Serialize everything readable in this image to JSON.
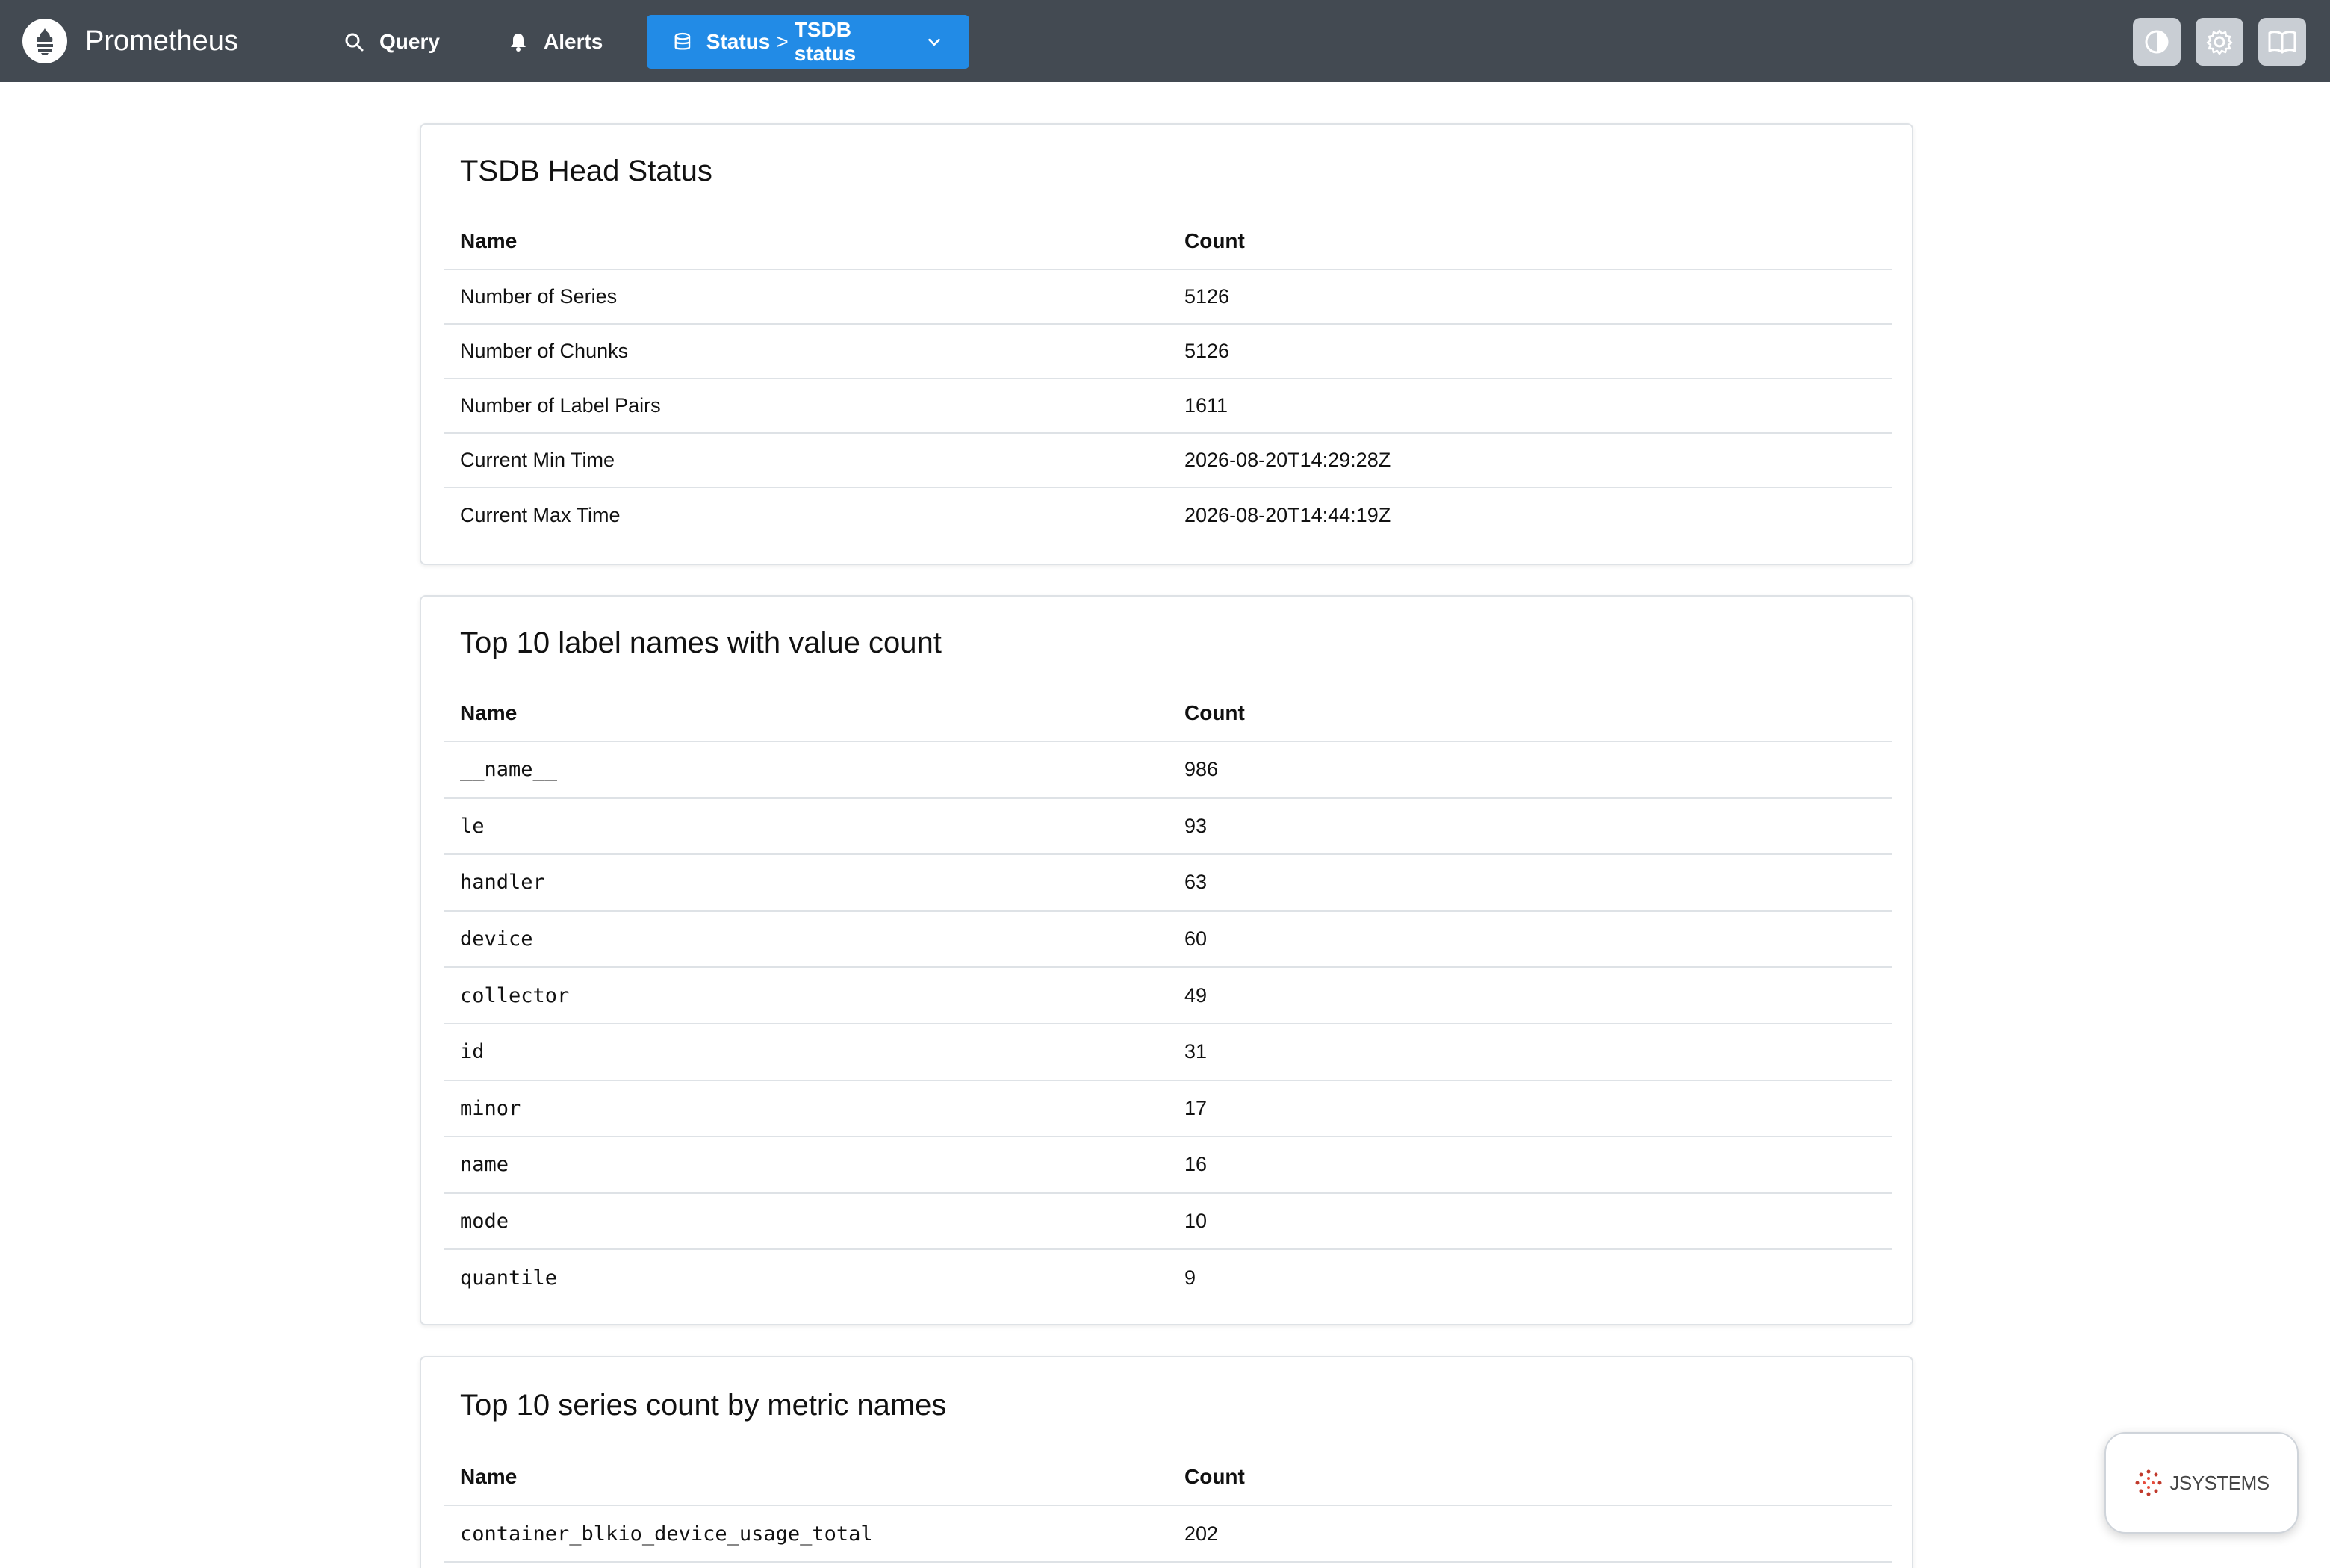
{
  "navbar": {
    "brand": "Prometheus",
    "query_label": "Query",
    "alerts_label": "Alerts",
    "status_label": "Status",
    "crumb_separator": ">",
    "status_page_label": "TSDB status",
    "bg_color": "#434a52",
    "active_color": "#228be6"
  },
  "head_status": {
    "title": "TSDB Head Status",
    "col_name": "Name",
    "col_count": "Count",
    "rows": [
      {
        "name": "Number of Series",
        "count": "5126"
      },
      {
        "name": "Number of Chunks",
        "count": "5126"
      },
      {
        "name": "Number of Label Pairs",
        "count": "1611"
      },
      {
        "name": "Current Min Time",
        "count": "2026-08-20T14:29:28Z"
      },
      {
        "name": "Current Max Time",
        "count": "2026-08-20T14:44:19Z"
      }
    ]
  },
  "label_names": {
    "title": "Top 10 label names with value count",
    "col_name": "Name",
    "col_count": "Count",
    "rows": [
      {
        "name": "__name__",
        "count": "986"
      },
      {
        "name": "le",
        "count": "93"
      },
      {
        "name": "handler",
        "count": "63"
      },
      {
        "name": "device",
        "count": "60"
      },
      {
        "name": "collector",
        "count": "49"
      },
      {
        "name": "id",
        "count": "31"
      },
      {
        "name": "minor",
        "count": "17"
      },
      {
        "name": "name",
        "count": "16"
      },
      {
        "name": "mode",
        "count": "10"
      },
      {
        "name": "quantile",
        "count": "9"
      }
    ]
  },
  "series_count": {
    "title": "Top 10 series count by metric names",
    "col_name": "Name",
    "col_count": "Count",
    "rows": [
      {
        "name": "container_blkio_device_usage_total",
        "count": "202"
      }
    ]
  },
  "badge": {
    "text": "JSYSTEMS",
    "icons": [
      "dotted-logo-icon"
    ]
  },
  "icons": [
    "prometheus-logo-icon",
    "search-icon",
    "bell-icon",
    "database-icon",
    "chevron-down-icon",
    "contrast-icon",
    "gear-icon",
    "book-icon"
  ]
}
